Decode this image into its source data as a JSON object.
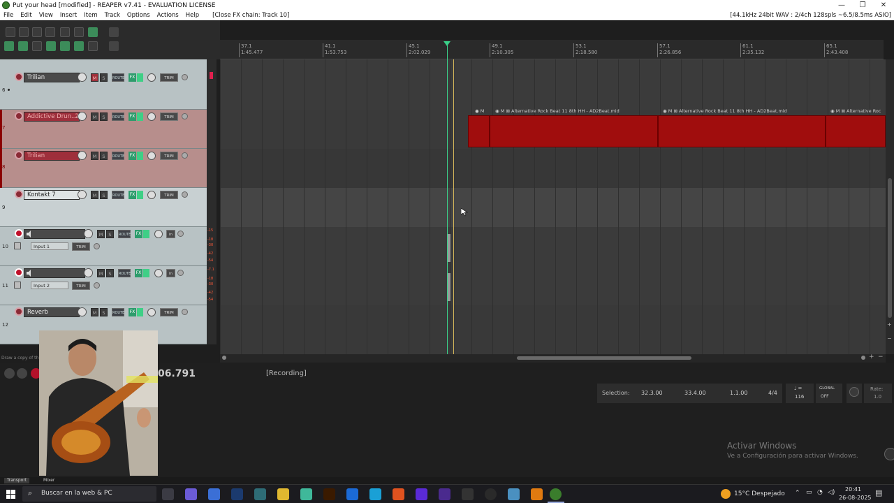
{
  "window": {
    "title": "Put your head [modified] - REAPER v7.41 - EVALUATION LICENSE",
    "controls": [
      "—",
      "❐",
      "✕"
    ]
  },
  "menu": {
    "items": [
      "File",
      "Edit",
      "View",
      "Insert",
      "Item",
      "Track",
      "Options",
      "Actions",
      "Help"
    ],
    "fx_chain": "[Close FX chain: Track 10]",
    "audio_status": "[44.1kHz 24bit WAV : 2/4ch 128spls ~6.5/8.5ms ASIO]"
  },
  "ruler": {
    "marks": [
      {
        "bar": "37.1",
        "time": "1:45.477"
      },
      {
        "bar": "41.1",
        "time": "1:53.753"
      },
      {
        "bar": "45.1",
        "time": "2:02.029"
      },
      {
        "bar": "49.1",
        "time": "2:10.305"
      },
      {
        "bar": "53.1",
        "time": "2:18.580"
      },
      {
        "bar": "57.1",
        "time": "2:26.856"
      },
      {
        "bar": "61.1",
        "time": "2:35.132"
      },
      {
        "bar": "65.1",
        "time": "2:43.408"
      }
    ]
  },
  "tracks": [
    {
      "number": "6",
      "name": "Trilian"
    },
    {
      "number": "7",
      "name": "Addictive Drun..2"
    },
    {
      "number": "8",
      "name": "Trilian"
    },
    {
      "number": "9",
      "name": "Kontakt 7"
    },
    {
      "number": "10",
      "name": "",
      "input": "Input 1"
    },
    {
      "number": "11",
      "name": "",
      "input": "Input 2"
    },
    {
      "number": "12",
      "name": "Reverb"
    }
  ],
  "track_buttons": {
    "mute": "M",
    "solo": "S",
    "route": "ROUTE",
    "fx": "FX",
    "trim": "TRIM",
    "in": "in"
  },
  "meter_labels": {
    "t10": [
      "-15",
      "-18",
      "-30",
      "-42",
      "-54"
    ],
    "t11": [
      "-7.1",
      "-18",
      "-30",
      "-42",
      "-54"
    ]
  },
  "midi_items": [
    {
      "label": "",
      "flags": "M"
    },
    {
      "label": "Alternative Rock Beat 11 8th HH - AD2Beat.mid",
      "flags": "M"
    },
    {
      "label": "Alternative Rock Beat 11 8th HH - AD2Beat.mid",
      "flags": "M"
    },
    {
      "label": "Alternative Roc",
      "flags": "M"
    }
  ],
  "status_hint": "Draw a copy of th",
  "transport": {
    "time": "06.791",
    "state": "[Recording]",
    "selection_label": "Selection:",
    "selection_start": "32.3.00",
    "selection_end": "33.4.00",
    "selection_length": "1.1.00",
    "time_signature": "4/4",
    "bpm_symbol": "♩ =",
    "bpm": "116",
    "global_label": "GLOBAL",
    "global_state": "OFF",
    "rate_label": "Rate:",
    "rate": "1.0"
  },
  "activation": {
    "title": "Activar Windows",
    "subtitle": "Ve a Configuración para activar Windows."
  },
  "dock_tabs": [
    "Transport",
    "Mixer"
  ],
  "taskbar": {
    "search_placeholder": "Buscar en la web & PC",
    "weather": "15°C  Despejado",
    "time": "20:41",
    "date": "26-08-2025"
  },
  "colors": {
    "selected_track": "#b78e8c",
    "midi_item": "#a00d0d",
    "play_cursor": "#3bd089",
    "edit_cursor": "#d4b65a"
  }
}
